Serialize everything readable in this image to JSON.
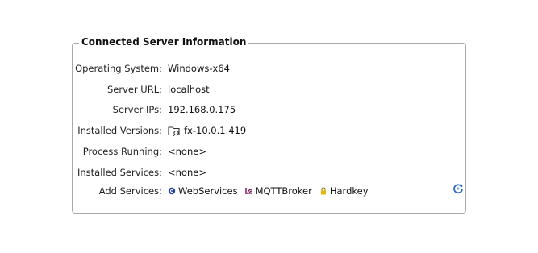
{
  "group": {
    "title": "Connected Server Information"
  },
  "fields": [
    {
      "label": "Operating System:",
      "value": "Windows-x64"
    },
    {
      "label": "Server URL:",
      "value": "localhost"
    },
    {
      "label": "Server IPs:",
      "value": "192.168.0.175"
    },
    {
      "label": "Installed Versions:",
      "value": "fx-10.0.1.419",
      "icon": "folder-search-icon"
    },
    {
      "label": "Process Running:",
      "value": "<none>"
    },
    {
      "label": "Installed Services:",
      "value": "<none>"
    }
  ],
  "add_services": {
    "label": "Add Services:",
    "items": [
      {
        "label": "WebServices",
        "icon": "globe-gear-icon",
        "color": "#1f3fa8"
      },
      {
        "label": "MQTTBroker",
        "icon": "mqtt-icon",
        "color": "#7a1a5a"
      },
      {
        "label": "Hardkey",
        "icon": "lock-icon",
        "color": "#d6a300"
      }
    ]
  },
  "refresh": {
    "icon": "refresh-icon",
    "color": "#2a66c9"
  }
}
